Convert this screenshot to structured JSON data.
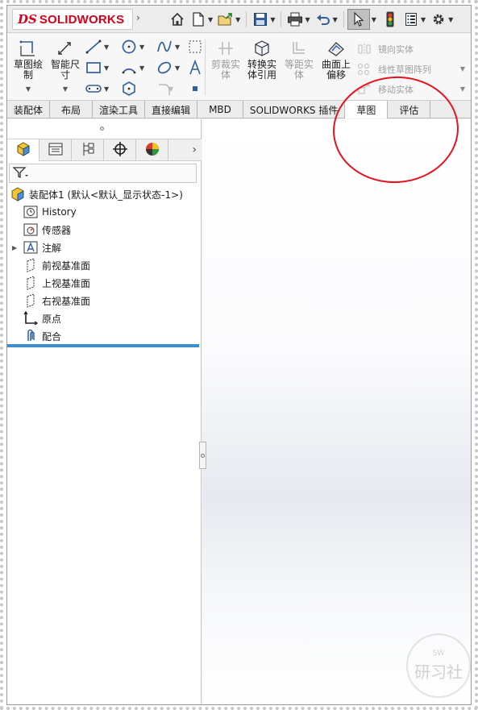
{
  "app": {
    "logo_mark": "DS",
    "logo_text": "SOLIDWORKS"
  },
  "quick_access": {
    "items": [
      "home-icon",
      "new-document-icon",
      "open-icon",
      "save-icon",
      "print-icon",
      "undo-icon",
      "select-pointer-icon",
      "traffic-light-icon",
      "file-properties-icon",
      "options-gear-icon"
    ]
  },
  "ribbon": {
    "sketch": "草图绘制",
    "smart_dimension": "智能尺寸",
    "trim_entities": "剪裁实体",
    "convert_entities": "转换实体引用",
    "offset_entities": "等距实体",
    "offset_on_surface": "曲面上偏移",
    "mirror_entities": "镜向实体",
    "linear_pattern": "线性草图阵列",
    "move_entities": "移动实体"
  },
  "tabs": [
    "装配体",
    "布局",
    "渲染工具",
    "直接编辑",
    "MBD",
    "SOLIDWORKS 插件",
    "草图",
    "评估"
  ],
  "active_tab_index": 6,
  "feature_tree": {
    "root": "装配体1  (默认<默认_显示状态-1>)",
    "items": [
      "History",
      "传感器",
      "注解",
      "前视基准面",
      "上视基准面",
      "右视基准面",
      "原点",
      "配合"
    ]
  },
  "watermark": {
    "top": "SW",
    "bottom": "研习社"
  },
  "colors": {
    "brand": "#d6001c",
    "annotation": "#e8121f",
    "rollback_bar": "#3b8fd1"
  }
}
